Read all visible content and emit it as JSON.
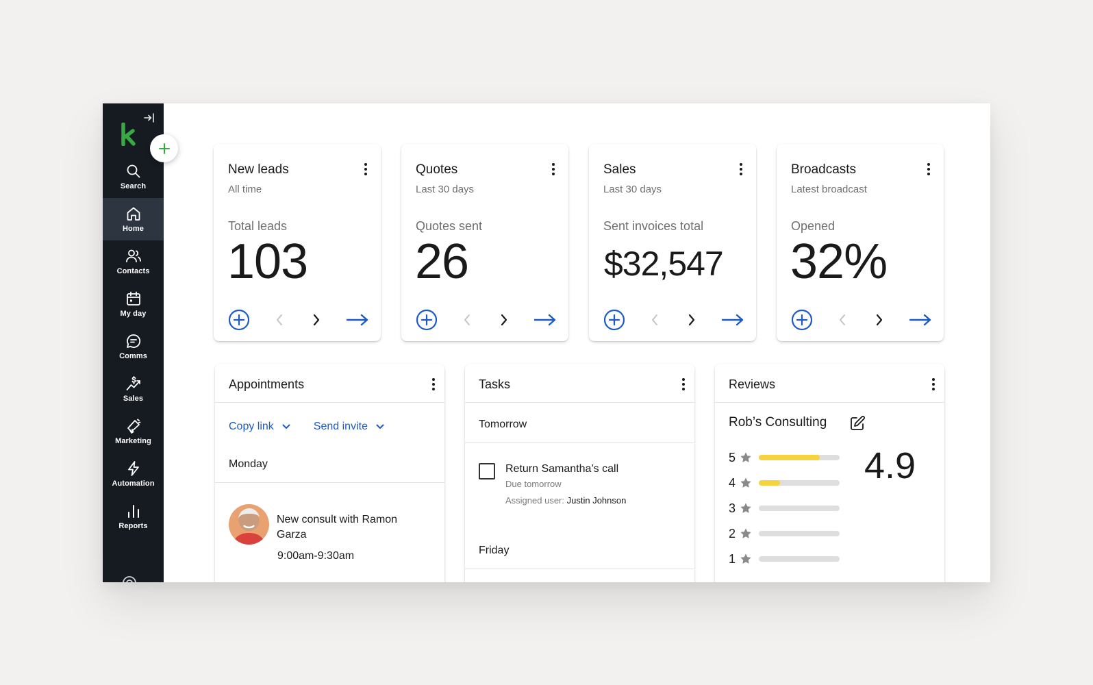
{
  "sidebar": {
    "nav": [
      {
        "label": "Search",
        "icon": "search-icon"
      },
      {
        "label": "Home",
        "icon": "home-icon"
      },
      {
        "label": "Contacts",
        "icon": "contacts-icon"
      },
      {
        "label": "My day",
        "icon": "calendar-icon"
      },
      {
        "label": "Comms",
        "icon": "chat-icon"
      },
      {
        "label": "Sales",
        "icon": "sales-icon"
      },
      {
        "label": "Marketing",
        "icon": "megaphone-icon"
      },
      {
        "label": "Automation",
        "icon": "lightning-icon"
      },
      {
        "label": "Reports",
        "icon": "bar-chart-icon"
      }
    ],
    "active": "Home"
  },
  "colors": {
    "sidebar_bg": "#161b22",
    "accent_blue": "#1c5bc6",
    "brand_green": "#3aa845",
    "rating_yellow": "#f5d33f"
  },
  "stats": [
    {
      "title": "New leads",
      "subtitle": "All time",
      "label": "Total leads",
      "value": "103"
    },
    {
      "title": "Quotes",
      "subtitle": "Last 30 days",
      "label": "Quotes sent",
      "value": "26"
    },
    {
      "title": "Sales",
      "subtitle": "Last 30 days",
      "label": "Sent invoices total",
      "value": "$32,547"
    },
    {
      "title": "Broadcasts",
      "subtitle": "Latest broadcast",
      "label": "Opened",
      "value": "32%"
    }
  ],
  "appointments": {
    "title": "Appointments",
    "copy_link": "Copy link",
    "send_invite": "Send invite",
    "day": "Monday",
    "item": {
      "title": "New consult with Ramon Garza",
      "time": "9:00am-9:30am"
    }
  },
  "tasks": {
    "title": "Tasks",
    "group1": "Tomorrow",
    "item": {
      "title": "Return Samantha’s call",
      "due": "Due tomorrow",
      "assigned_label": "Assigned user:",
      "assigned_user": "Justin Johnson"
    },
    "group2": "Friday"
  },
  "reviews": {
    "title": "Reviews",
    "business": "Rob’s Consulting",
    "average": "4.9",
    "distribution": [
      {
        "stars": "5",
        "share": 0.75
      },
      {
        "stars": "4",
        "share": 0.26
      },
      {
        "stars": "3",
        "share": 0
      },
      {
        "stars": "2",
        "share": 0
      },
      {
        "stars": "1",
        "share": 0
      }
    ]
  }
}
